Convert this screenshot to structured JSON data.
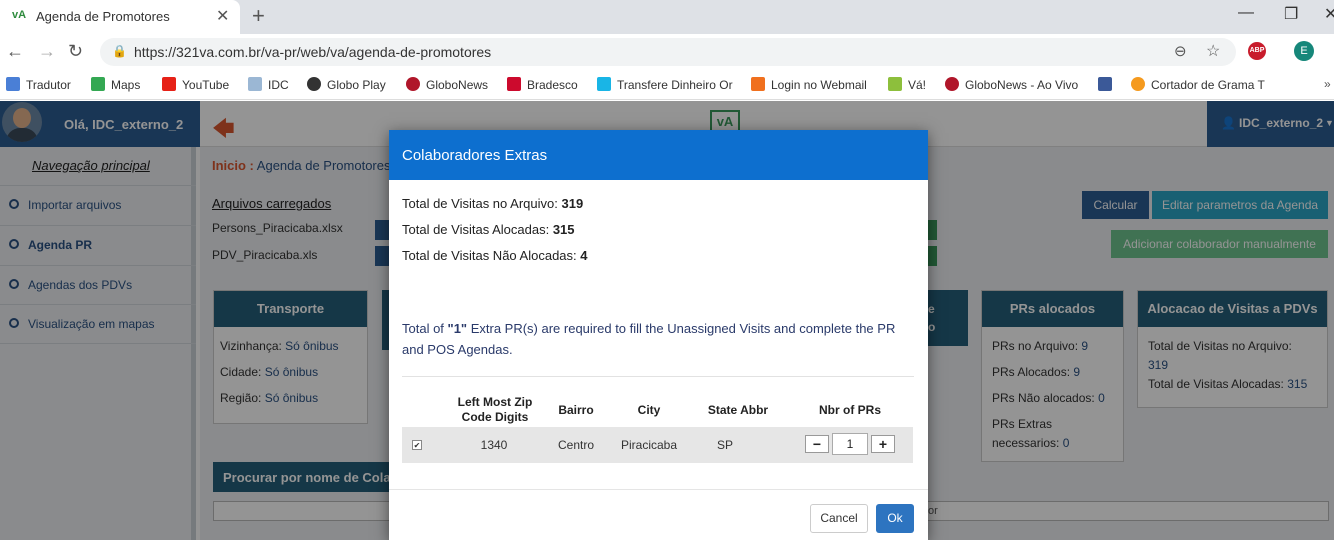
{
  "browser": {
    "tab_title": "Agenda de Promotores",
    "tab_favicon": "vA",
    "url": "https://321va.com.br/va-pr/web/va/agenda-de-promotores",
    "abp_label": "ABP",
    "profile_initial": "E",
    "bookmarks": [
      "Tradutor",
      "Maps",
      "YouTube",
      "IDC",
      "Globo Play",
      "GloboNews",
      "Bradesco",
      "Transfere Dinheiro Or",
      "Login no Webmail",
      "Vá!",
      "GloboNews - Ao Vivo",
      "Cortador de Grama T"
    ]
  },
  "app": {
    "greeting": "Olá, IDC_externo_2",
    "user_menu": "IDC_externo_2",
    "nav_title": "Navegação principal",
    "nav_items": [
      "Importar arquivos",
      "Agenda PR",
      "Agendas dos PDVs",
      "Visualização em mapas"
    ],
    "breadcrumb_home": "Inicio :",
    "breadcrumb_page": "Agenda de Promotores",
    "files_title": "Arquivos carregados",
    "files": [
      "Persons_Piracicaba.xlsx",
      "PDV_Piracicaba.xls"
    ],
    "buttons": {
      "calcular": "Calcular",
      "editar": "Editar parametros da Agenda",
      "adicionar": "Adicionar colaborador manualmente"
    },
    "transporte": {
      "title": "Transporte",
      "rows": [
        {
          "label": "Vizinhança:",
          "value": "Só ônibus"
        },
        {
          "label": "Cidade:",
          "value": "Só ônibus"
        },
        {
          "label": "Região:",
          "value": "Só ônibus"
        }
      ]
    },
    "hidden_panel_fragment": "e\no",
    "prs": {
      "title": "PRs alocados",
      "rows": [
        {
          "label": "PRs no Arquivo:",
          "value": "9"
        },
        {
          "label": "PRs Alocados:",
          "value": "9"
        },
        {
          "label": "PRs Não alocados:",
          "value": "0"
        },
        {
          "label": "PRs Extras",
          "value": ""
        },
        {
          "label": "necessarios:",
          "value": "0"
        }
      ]
    },
    "alocacao": {
      "title": "Alocacao de Visitas a PDVs",
      "rows": [
        {
          "label": "Total de Visitas no Arquivo:",
          "value": ""
        },
        {
          "label": "",
          "value": "319"
        },
        {
          "label": "Total de Visitas Alocadas:",
          "value": "315"
        }
      ]
    },
    "search_title": "Procurar por nome de Colabo",
    "search_tail": "or"
  },
  "modal": {
    "title": "Colaboradores Extras",
    "lines": [
      {
        "label": "Total de Visitas no Arquivo:",
        "value": "319"
      },
      {
        "label": "Total de Visitas Alocadas:",
        "value": "315"
      },
      {
        "label": "Total de Visitas Não Alocadas:",
        "value": "4"
      }
    ],
    "message_pre": "Total of ",
    "message_count": "\"1\"",
    "message_post": " Extra PR(s) are required to fill the Unassigned Visits and complete the PR and POS Agendas.",
    "columns": [
      "Left Most Zip Code Digits",
      "Bairro",
      "City",
      "State Abbr",
      "Nbr of PRs"
    ],
    "row": {
      "checked": true,
      "zip": "1340",
      "bairro": "Centro",
      "city": "Piracicaba",
      "state": "SP",
      "nbr": "1"
    },
    "cancel": "Cancel",
    "ok": "Ok"
  }
}
